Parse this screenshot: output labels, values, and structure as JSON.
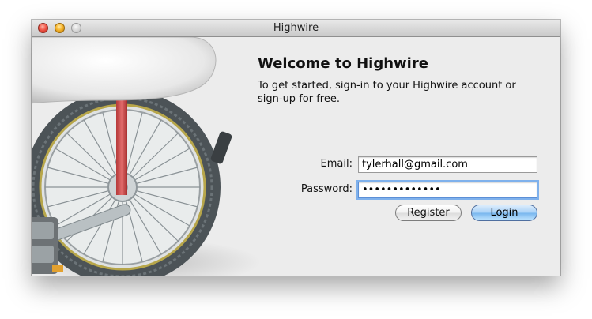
{
  "window": {
    "title": "Highwire"
  },
  "header": {
    "welcome": "Welcome to Highwire",
    "intro": "To get started, sign-in to your Highwire account or sign-up for free."
  },
  "form": {
    "email_label": "Email:",
    "email_value": "tylerhall@gmail.com",
    "password_label": "Password:",
    "password_value": "•••••••••••••",
    "register_label": "Register",
    "login_label": "Login"
  },
  "icons": {
    "close": "close-window-icon",
    "minimize": "minimize-window-icon",
    "zoom": "zoom-window-icon",
    "art": "unicycle-illustration"
  },
  "colors": {
    "window_bg": "#ececec",
    "login_button": "#78b6ee",
    "focus_ring": "#7fb1ec"
  }
}
